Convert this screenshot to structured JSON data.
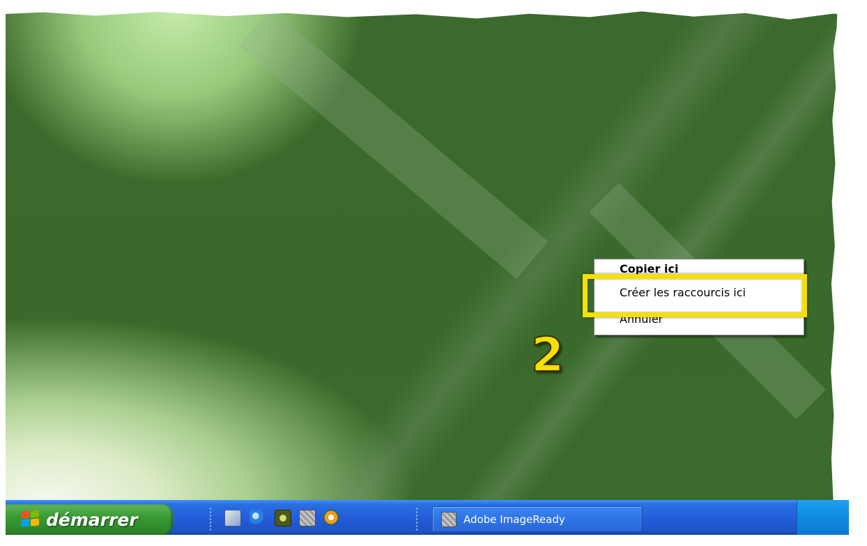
{
  "context_menu": {
    "items": [
      {
        "label": "Copier ici"
      },
      {
        "label": "Créer les raccourcis ici"
      },
      {
        "label": "Annuler"
      }
    ]
  },
  "annotation": {
    "step_number": "2"
  },
  "taskbar": {
    "start_label": "démarrer",
    "quick_launch_icons": [
      "outlook-express-icon",
      "internet-explorer-icon",
      "media-center-icon",
      "imageready-icon",
      "media-player-icon"
    ],
    "task_buttons": [
      {
        "label": "Adobe ImageReady",
        "icon": "imageready-icon"
      }
    ]
  },
  "colors": {
    "highlight": "#f5e000",
    "taskbar": "#245edb",
    "start_button": "#3a9c36",
    "desktop": "#3c6a2c"
  }
}
